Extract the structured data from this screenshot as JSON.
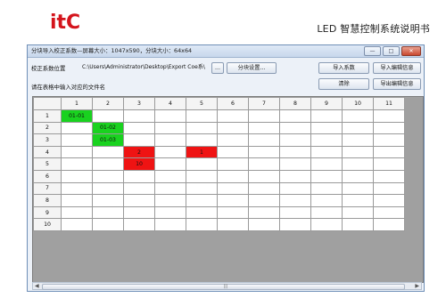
{
  "page": {
    "logo_text": "itC",
    "doc_title": "LED 智慧控制系统说明书"
  },
  "window": {
    "title": "分块导入校正系数—屏幕大小：1047x590，分块大小：64x64",
    "controls": [
      "min",
      "max",
      "close"
    ],
    "path_label": "校正系数位置",
    "path_value": "C:\\Users\\Administrator\\Desktop\\Export Coe系\\",
    "browse_label": "...",
    "split_settings_label": "分块设置...",
    "import_coef_label": "导入系数",
    "import_edit_label": "导入编辑信息",
    "clear_label": "清除",
    "export_edit_label": "导出编辑信息",
    "hint": "请在表格中输入对应的文件名"
  },
  "grid": {
    "columns": [
      "1",
      "2",
      "3",
      "4",
      "5",
      "6",
      "7",
      "8",
      "9",
      "10",
      "11"
    ],
    "rows": [
      {
        "label": "1",
        "cells": [
          "01-01",
          "",
          "",
          "",
          "",
          "",
          "",
          "",
          "",
          "",
          ""
        ]
      },
      {
        "label": "2",
        "cells": [
          "",
          "01-02",
          "",
          "",
          "",
          "",
          "",
          "",
          "",
          "",
          ""
        ]
      },
      {
        "label": "3",
        "cells": [
          "",
          "01-03",
          "",
          "",
          "",
          "",
          "",
          "",
          "",
          "",
          ""
        ]
      },
      {
        "label": "4",
        "cells": [
          "",
          "",
          "2",
          "",
          "1",
          "",
          "",
          "",
          "",
          "",
          ""
        ]
      },
      {
        "label": "5",
        "cells": [
          "",
          "",
          "10",
          "",
          "",
          "",
          "",
          "",
          "",
          "",
          ""
        ]
      },
      {
        "label": "6",
        "cells": [
          "",
          "",
          "",
          "",
          "",
          "",
          "",
          "",
          "",
          "",
          ""
        ]
      },
      {
        "label": "7",
        "cells": [
          "",
          "",
          "",
          "",
          "",
          "",
          "",
          "",
          "",
          "",
          ""
        ]
      },
      {
        "label": "8",
        "cells": [
          "",
          "",
          "",
          "",
          "",
          "",
          "",
          "",
          "",
          "",
          ""
        ]
      },
      {
        "label": "9",
        "cells": [
          "",
          "",
          "",
          "",
          "",
          "",
          "",
          "",
          "",
          "",
          ""
        ]
      },
      {
        "label": "10",
        "cells": [
          "",
          "",
          "",
          "",
          "",
          "",
          "",
          "",
          "",
          "",
          ""
        ]
      }
    ],
    "highlights": {
      "green": "#19d21f",
      "red": "#ef1313",
      "green_cells": [
        [
          0,
          0
        ],
        [
          1,
          1
        ],
        [
          2,
          1
        ]
      ],
      "red_cells": [
        [
          3,
          2
        ],
        [
          3,
          4
        ],
        [
          4,
          2
        ]
      ]
    }
  },
  "colors": {
    "brand_red": "#d4141c",
    "window_border": "#6f8fb7"
  }
}
